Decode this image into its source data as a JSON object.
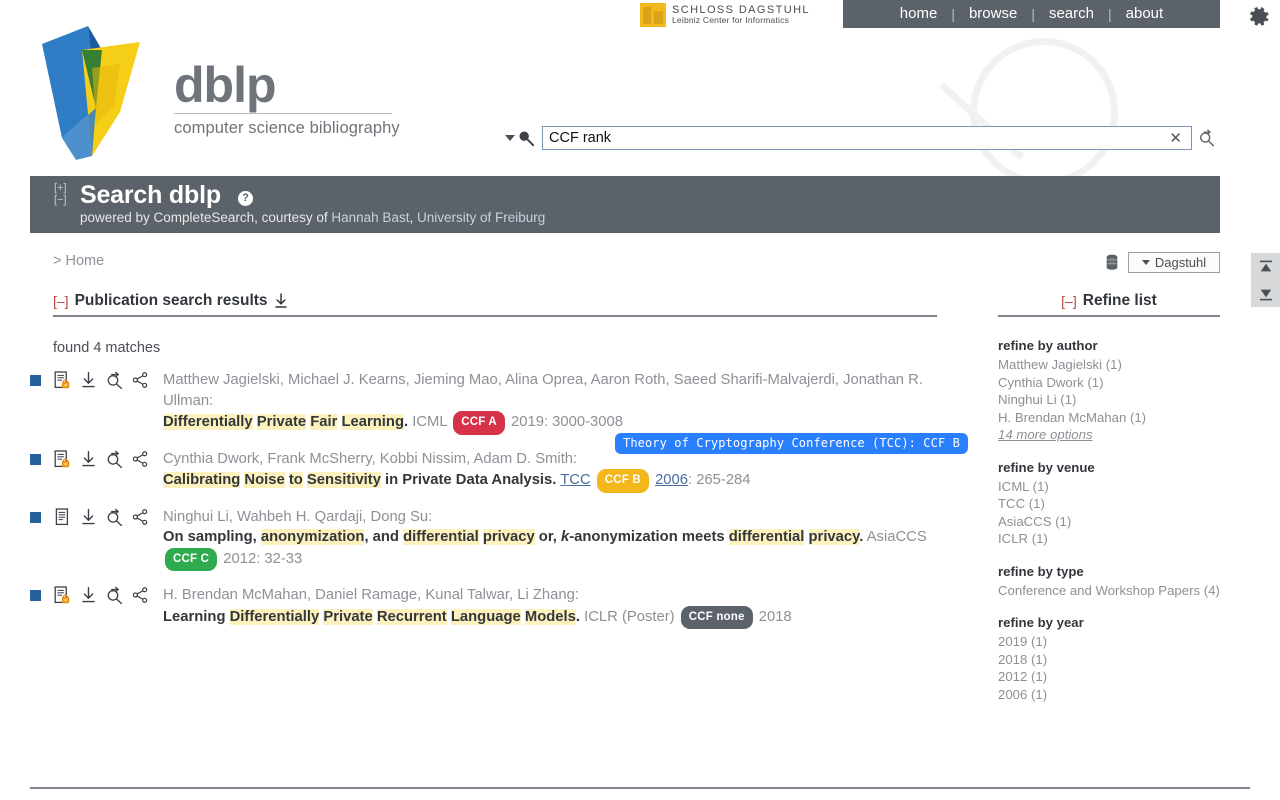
{
  "topnav": {
    "items": [
      {
        "label": "home"
      },
      {
        "label": "browse"
      },
      {
        "label": "search"
      },
      {
        "label": "about"
      }
    ],
    "separator": "|",
    "gear_icon": "gear-icon"
  },
  "dagstuhl": {
    "line1": "SCHLOSS DAGSTUHL",
    "line2": "Leibniz Center for Informatics"
  },
  "logo": {
    "wordmark": "dblp",
    "tagline": "computer science bibliography"
  },
  "search": {
    "value": "CCF rank",
    "placeholder": "",
    "clear_label": "✕",
    "magnifier_icon": "search-icon",
    "caret_icon": "chevron-down-icon",
    "go_icon": "search-refine-icon"
  },
  "banner": {
    "expand": "[+]",
    "collapse": "[−]",
    "title": "Search dblp",
    "help": "?",
    "subtitle_pre": "powered by CompleteSearch, courtesy of ",
    "subtitle_link1": "Hannah Bast",
    "subtitle_mid": ", ",
    "subtitle_link2": "University of Freiburg"
  },
  "breadcrumb": {
    "text": "> Home",
    "home_label": "Home"
  },
  "db_selector": {
    "db_icon": "database-icon",
    "label": "Dagstuhl"
  },
  "results_section": {
    "toggle": "[–]",
    "title": "Publication search results",
    "download_icon": "download-icon",
    "found_text": "found 4 matches"
  },
  "refine_section": {
    "toggle": "[–]",
    "title": "Refine list"
  },
  "tooltip": {
    "text": "Theory of Cryptography Conference (TCC): CCF B"
  },
  "results": [
    {
      "bullet": "selection-square",
      "icons": [
        "open-access-document-icon",
        "download-icon",
        "search-refine-icon",
        "share-icon"
      ],
      "authors": "Matthew Jagielski, Michael J. Kearns, Jieming Mao, Alina Oprea, Aaron Roth, Saeed Sharifi-Malvajerdi, Jonathan R. Ullman:",
      "title_parts": [
        {
          "t": "Differentially",
          "hi": true
        },
        {
          "t": " ",
          "hi": false
        },
        {
          "t": "Private",
          "hi": true
        },
        {
          "t": " ",
          "hi": false
        },
        {
          "t": "Fair",
          "hi": true
        },
        {
          "t": " ",
          "hi": false
        },
        {
          "t": "Learning",
          "hi": true
        }
      ],
      "title_suffix": ".",
      "venue": "ICML",
      "venue_link": false,
      "ccf": "CCF A",
      "ccf_class": "ccf-a",
      "year": "2019",
      "year_link": false,
      "pages": ": 3000-3008"
    },
    {
      "bullet": "selection-square",
      "icons": [
        "open-access-document-icon",
        "download-icon",
        "search-refine-icon",
        "share-icon"
      ],
      "authors": "Cynthia Dwork, Frank McSherry, Kobbi Nissim, Adam D. Smith:",
      "title_parts": [
        {
          "t": "Calibrating",
          "hi": true
        },
        {
          "t": " ",
          "hi": false
        },
        {
          "t": "Noise",
          "hi": true
        },
        {
          "t": " ",
          "hi": false
        },
        {
          "t": "to",
          "hi": true
        },
        {
          "t": " ",
          "hi": false
        },
        {
          "t": "Sensitivity",
          "hi": true
        },
        {
          "t": " in Private Data Analysis",
          "hi": false
        }
      ],
      "title_suffix": ".",
      "venue": "TCC",
      "venue_link": true,
      "ccf": "CCF B",
      "ccf_class": "ccf-b",
      "year": "2006",
      "year_link": true,
      "pages": ": 265-284"
    },
    {
      "bullet": "selection-square",
      "icons": [
        "document-icon",
        "download-icon",
        "search-refine-icon",
        "share-icon"
      ],
      "authors": "Ninghui Li, Wahbeh H. Qardaji, Dong Su:",
      "title_parts": [
        {
          "t": "On sampling, ",
          "hi": false
        },
        {
          "t": "anonymization",
          "hi": true
        },
        {
          "t": ", and ",
          "hi": false
        },
        {
          "t": "differential",
          "hi": true
        },
        {
          "t": " ",
          "hi": false
        },
        {
          "t": "privacy",
          "hi": true
        },
        {
          "t": " or, ",
          "hi": false
        },
        {
          "t": "k",
          "hi": false,
          "italic": true
        },
        {
          "t": "-anonymization meets ",
          "hi": false
        },
        {
          "t": "differential",
          "hi": true
        },
        {
          "t": " ",
          "hi": false
        },
        {
          "t": "privacy",
          "hi": true
        }
      ],
      "title_suffix": ".",
      "venue": "AsiaCCS",
      "venue_link": false,
      "ccf": "CCF C",
      "ccf_class": "ccf-c",
      "year": "2012",
      "year_link": false,
      "pages": ": 32-33"
    },
    {
      "bullet": "selection-square",
      "icons": [
        "open-access-document-icon",
        "download-icon",
        "search-refine-icon",
        "share-icon"
      ],
      "authors": "H. Brendan McMahan, Daniel Ramage, Kunal Talwar, Li Zhang:",
      "title_parts": [
        {
          "t": "Learning ",
          "hi": false
        },
        {
          "t": "Differentially",
          "hi": true
        },
        {
          "t": " ",
          "hi": false
        },
        {
          "t": "Private",
          "hi": true
        },
        {
          "t": " ",
          "hi": false
        },
        {
          "t": "Recurrent",
          "hi": true
        },
        {
          "t": " ",
          "hi": false
        },
        {
          "t": "Language",
          "hi": true
        },
        {
          "t": " ",
          "hi": false
        },
        {
          "t": "Models",
          "hi": true
        }
      ],
      "title_suffix": ".",
      "venue": "ICLR (Poster)",
      "venue_link": false,
      "ccf": "CCF none",
      "ccf_class": "ccf-none",
      "year": "2018",
      "year_link": false,
      "pages": ""
    }
  ],
  "refine_groups": [
    {
      "title": "refine by author",
      "options": [
        "Matthew Jagielski (1)",
        "Cynthia Dwork (1)",
        "Ninghui Li (1)",
        "H. Brendan McMahan (1)"
      ],
      "more": "14 more options"
    },
    {
      "title": "refine by venue",
      "options": [
        "ICML (1)",
        "TCC (1)",
        "AsiaCCS (1)",
        "ICLR (1)"
      ],
      "more": ""
    },
    {
      "title": "refine by type",
      "options": [
        "Conference and Workshop Papers (4)"
      ],
      "more": ""
    },
    {
      "title": "refine by year",
      "options": [
        "2019 (1)",
        "2018 (1)",
        "2012 (1)",
        "2006 (1)"
      ],
      "more": ""
    }
  ],
  "scroll_controls": {
    "top_icon": "scroll-to-top-icon",
    "bottom_icon": "scroll-to-bottom-icon"
  },
  "colors": {
    "brand_grey": "#5b6269",
    "dblp_blue": "#2f7dc4",
    "dblp_yellow": "#f5cf17",
    "ccf_a": "#d6334a",
    "ccf_b": "#f4b71a",
    "ccf_c": "#2eaa4f",
    "ccf_none": "#5b6269",
    "highlight": "#fdf2bd",
    "tooltip_blue": "#2a7fff"
  }
}
